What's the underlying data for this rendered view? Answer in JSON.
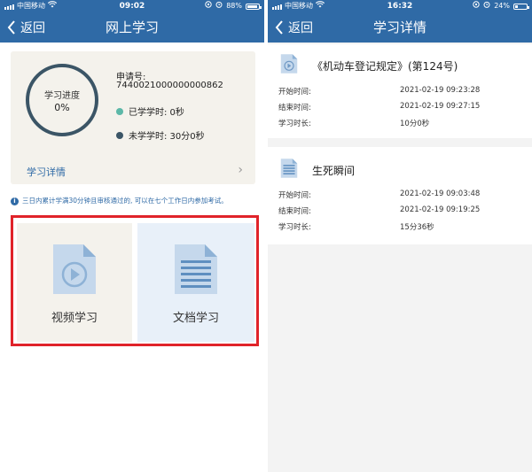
{
  "left": {
    "status": {
      "carrier": "中国移动",
      "time": "09:02",
      "battery": "88%",
      "battery_level": 0.88
    },
    "nav": {
      "back": "返回",
      "title": "网上学习"
    },
    "progress": {
      "ring_label": "学习进度",
      "percent": "0%",
      "apply_label": "申请号:",
      "apply_no": "7440021000000000862",
      "studied": "已学学时: 0秒",
      "remaining": "未学学时: 30分0秒",
      "detail_link": "学习详情"
    },
    "notice": "三日内累计学满30分钟且审核通过的, 可以在七个工作日内参加考试。",
    "tiles": {
      "video": "视频学习",
      "doc": "文档学习"
    },
    "colors": {
      "accent": "#2f6aa6",
      "studied_dot": "#5cb8a8",
      "remaining_dot": "#3b5566",
      "highlight": "#e0232a"
    }
  },
  "right": {
    "status": {
      "carrier": "中国移动",
      "time": "16:32",
      "battery": "24%",
      "battery_level": 0.24
    },
    "nav": {
      "back": "返回",
      "title": "学习详情"
    },
    "items": [
      {
        "title": "《机动车登记规定》(第124号)",
        "rows": [
          {
            "k": "开始时间:",
            "v": "2021-02-19 09:23:28"
          },
          {
            "k": "结束时间:",
            "v": "2021-02-19 09:27:15"
          },
          {
            "k": "学习时长:",
            "v": "10分0秒"
          }
        ]
      },
      {
        "title": "生死瞬间",
        "rows": [
          {
            "k": "开始时间:",
            "v": "2021-02-19 09:03:48"
          },
          {
            "k": "结束时间:",
            "v": "2021-02-19 09:19:25"
          },
          {
            "k": "学习时长:",
            "v": "15分36秒"
          }
        ]
      }
    ]
  }
}
